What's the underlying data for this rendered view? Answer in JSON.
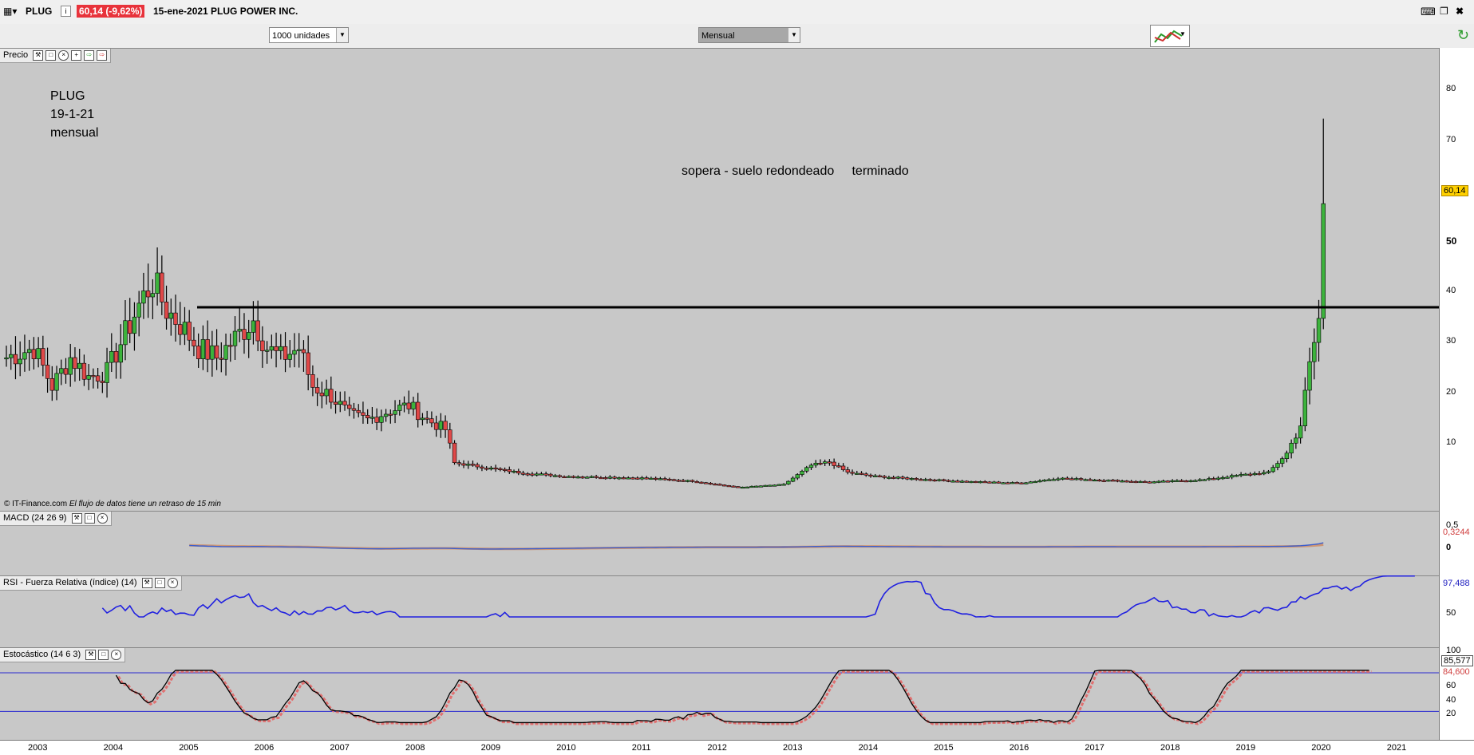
{
  "title_bar": {
    "symbol": "PLUG",
    "info_glyph": "i",
    "change_badge": "60,14 (-9,62%)",
    "date_name": "15-ene-2021 PLUG POWER INC."
  },
  "toolbar": {
    "units": "1000 unidades",
    "period": "Mensual"
  },
  "price_panel": {
    "label": "Precio",
    "note_lines": [
      "PLUG",
      "19-1-21",
      "mensual"
    ],
    "annotation": "sopera - suelo redondeado     terminado",
    "copyright": "© IT-Finance.com",
    "delay_note": "El flujo de datos tiene un retraso de 15 min",
    "ticks": [
      "80",
      "70",
      "60",
      "50",
      "40",
      "30",
      "20",
      "10"
    ],
    "last_tag": "60,14",
    "resistance_level": 38.5
  },
  "macd_panel": {
    "label": "MACD (24 26 9)",
    "ticks": [
      "0,5",
      "0"
    ],
    "last_tag": "0,3244"
  },
  "rsi_panel": {
    "label": "RSI - Fuerza Relativa (índice) (14)",
    "ticks": [
      "50"
    ],
    "last_tag": "97,488"
  },
  "stoch_panel": {
    "label": "Estocástico (14 6 3)",
    "ticks": [
      "100",
      "60",
      "40",
      "20"
    ],
    "tag1": "85,577",
    "tag2": "84,600"
  },
  "x_axis": {
    "labels": [
      "2003",
      "2004",
      "2005",
      "2006",
      "2007",
      "2008",
      "2009",
      "2010",
      "2011",
      "2012",
      "2013",
      "2014",
      "2015",
      "2016",
      "2017",
      "2018",
      "2019",
      "2020",
      "2021"
    ]
  },
  "colors": {
    "up": "#3cb33c",
    "down": "#e04848",
    "badge": "#e8333b",
    "resistance": "#000000",
    "rsi": "#2020e0",
    "macd_line": "#3a5fd0",
    "macd_fill_up": "#4caf50",
    "macd_fill_dn": "#e05050",
    "stoch_k": "#000000",
    "stoch_d": "#e07070",
    "band": "#2a2ad0"
  },
  "chart_data": {
    "type": "candlestick",
    "x_start": "2002-09",
    "y_range": [
      0,
      85
    ],
    "anchors": [
      [
        0,
        28
      ],
      [
        6,
        30
      ],
      [
        10,
        22
      ],
      [
        14,
        28
      ],
      [
        18,
        24
      ],
      [
        22,
        25
      ],
      [
        26,
        33
      ],
      [
        29,
        39
      ],
      [
        32,
        44
      ],
      [
        35,
        38
      ],
      [
        38,
        35
      ],
      [
        42,
        30
      ],
      [
        46,
        28
      ],
      [
        50,
        32
      ],
      [
        54,
        36
      ],
      [
        57,
        30
      ],
      [
        60,
        28
      ],
      [
        64,
        30
      ],
      [
        67,
        22
      ],
      [
        71,
        20
      ],
      [
        75,
        16
      ],
      [
        79,
        15
      ],
      [
        84,
        17
      ],
      [
        88,
        18
      ],
      [
        92,
        15
      ],
      [
        96,
        13
      ],
      [
        98,
        6
      ],
      [
        105,
        5
      ],
      [
        112,
        4
      ],
      [
        122,
        3.2
      ],
      [
        132,
        3
      ],
      [
        140,
        2.8
      ],
      [
        150,
        2.2
      ],
      [
        160,
        0.9
      ],
      [
        170,
        1.5
      ],
      [
        176,
        5.5
      ],
      [
        180,
        6.2
      ],
      [
        184,
        4
      ],
      [
        190,
        3.2
      ],
      [
        200,
        2.6
      ],
      [
        210,
        2.1
      ],
      [
        222,
        1.8
      ],
      [
        230,
        2.8
      ],
      [
        240,
        2.4
      ],
      [
        250,
        2
      ],
      [
        262,
        2.5
      ],
      [
        270,
        3.5
      ],
      [
        276,
        4
      ],
      [
        280,
        8
      ],
      [
        283,
        14
      ],
      [
        285,
        26
      ],
      [
        287,
        36
      ],
      [
        288,
        60.14
      ]
    ],
    "resistance": 38.5,
    "last_close": 60.14
  }
}
